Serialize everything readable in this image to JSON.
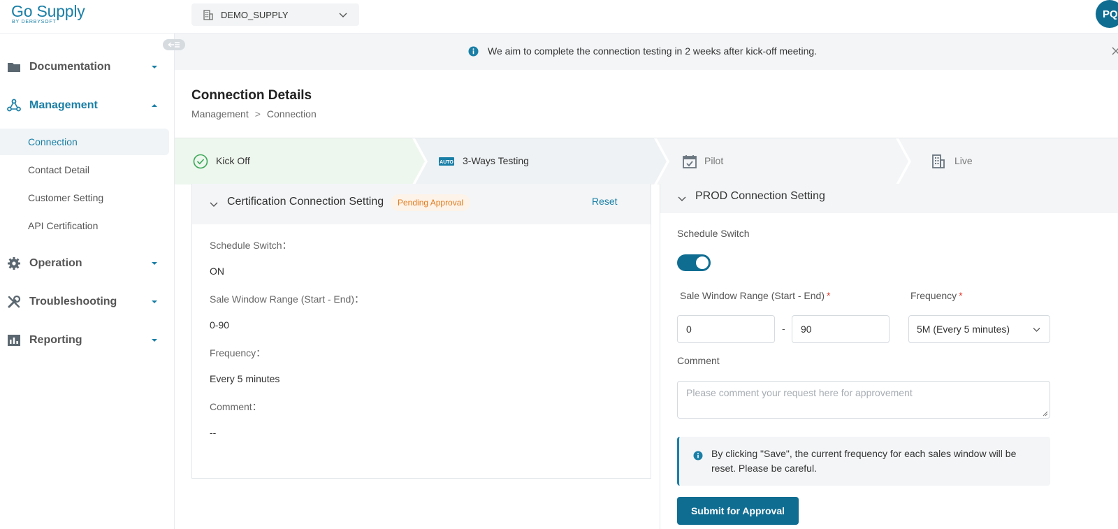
{
  "brand": {
    "name": "Go Supply",
    "sub": "BY DERBYSOFT"
  },
  "header": {
    "supplier": "DEMO_SUPPLY",
    "avatar_initials": "PQ"
  },
  "sidebar": {
    "groups": [
      {
        "label": "Documentation",
        "icon": "folder-icon"
      },
      {
        "label": "Management",
        "icon": "network-icon",
        "active": true,
        "items": [
          "Connection",
          "Contact Detail",
          "Customer Setting",
          "API Certification"
        ]
      },
      {
        "label": "Operation",
        "icon": "gear-icon"
      },
      {
        "label": "Troubleshooting",
        "icon": "tools-icon"
      },
      {
        "label": "Reporting",
        "icon": "chart-icon"
      }
    ]
  },
  "notice": {
    "text": "We aim to complete the connection testing in 2 weeks after kick-off meeting."
  },
  "page": {
    "title": "Connection Details",
    "breadcrumb": [
      "Management",
      ">",
      "Connection"
    ]
  },
  "steps": [
    {
      "label": "Kick Off",
      "status": "done"
    },
    {
      "label": "3-Ways Testing",
      "status": "current",
      "icon_text": "AUTO"
    },
    {
      "label": "Pilot",
      "status": "pending"
    },
    {
      "label": "Live",
      "status": "pending"
    }
  ],
  "cert_setting": {
    "title": "Certification Connection Setting",
    "badge": "Pending Approval",
    "reset": "Reset",
    "schedule_switch_label": "Schedule Switch：",
    "schedule_switch_value": "ON",
    "sale_window_label": "Sale Window Range (Start - End)：",
    "sale_window_value": "0-90",
    "frequency_label": "Frequency：",
    "frequency_value": "Every 5 minutes",
    "comment_label": "Comment：",
    "comment_value": "--"
  },
  "prod_setting": {
    "title": "PROD Connection Setting",
    "schedule_switch_label": "Schedule Switch",
    "schedule_switch_on": true,
    "sale_window_label": "Sale Window Range (Start - End)",
    "required_mark": "*",
    "start_value": "0",
    "dash": "-",
    "end_value": "90",
    "frequency_label": "Frequency",
    "frequency_value": "5M (Every 5 minutes)",
    "comment_label": "Comment",
    "comment_placeholder": "Please comment your request here for approvement",
    "alert_text": "By clicking \"Save\", the current frequency for each sales window will be reset. Please be careful.",
    "submit_label": "Submit for Approval"
  },
  "colors": {
    "primary": "#0f6d92",
    "link": "#1a7fa6",
    "badge_text": "#e07a1f",
    "done_green": "#3aa757"
  }
}
